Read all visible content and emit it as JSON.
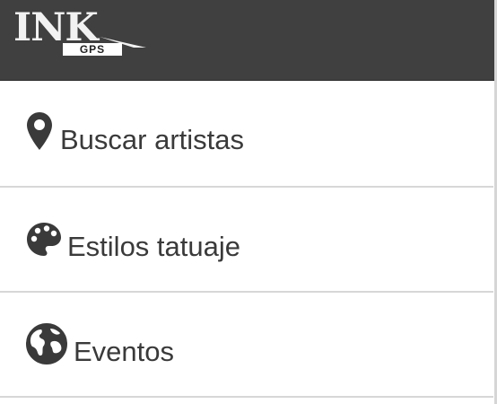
{
  "header": {
    "logo_text": "INK",
    "logo_subtext": "GPS",
    "background_color": "#404040"
  },
  "menu": {
    "items": [
      {
        "label": "Buscar artistas",
        "icon": "map-marker-icon"
      },
      {
        "label": "Estilos tatuaje",
        "icon": "palette-icon"
      },
      {
        "label": "Eventos",
        "icon": "globe-icon"
      }
    ]
  },
  "colors": {
    "text": "#3a3a3a",
    "divider": "#d7d7d7"
  }
}
